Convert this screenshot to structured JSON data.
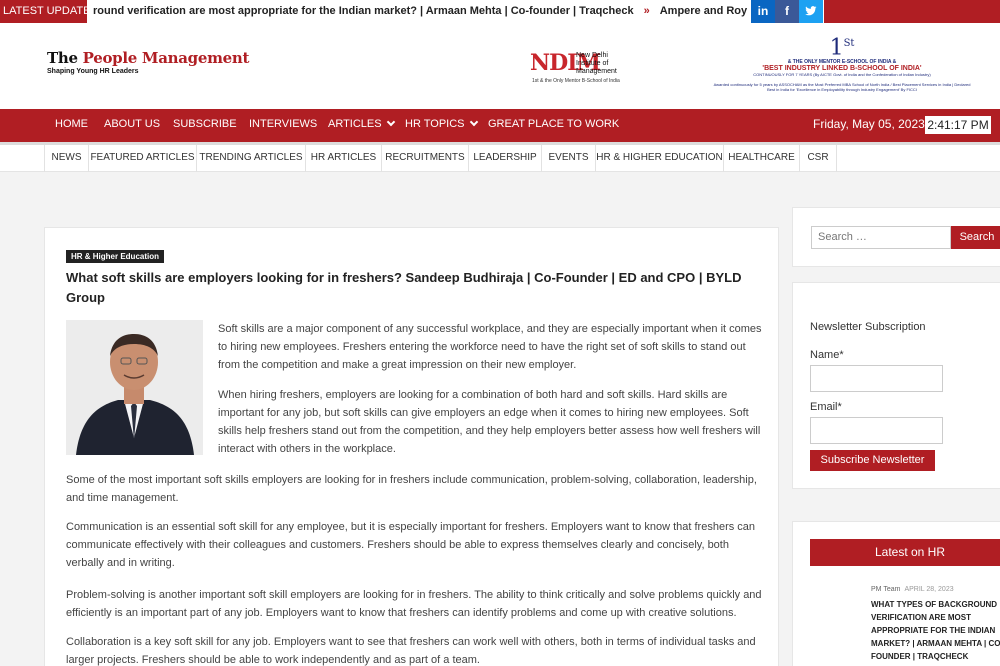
{
  "ticker": {
    "label": "LATEST UPDATES",
    "items": [
      "round verification are most appropriate for the Indian market? | Armaan Mehta | Co-founder | Traqcheck",
      "Ampere and Royal Challenger Bangal"
    ],
    "separator": "»"
  },
  "social": [
    {
      "icon": "linkedin-icon",
      "glyph": "in",
      "color": "#0a66c2"
    },
    {
      "icon": "facebook-icon",
      "glyph": "f",
      "color": "#3b5998"
    },
    {
      "icon": "twitter-icon",
      "glyph": "t",
      "color": "#1da1f2"
    }
  ],
  "brand": {
    "title_a": "The ",
    "title_b": "People Management",
    "tagline": "Shaping Young HR Leaders"
  },
  "ndim": {
    "mark": "NDIM",
    "name": "New Delhi Institute of Management",
    "sub": "1st & the Only Mentor B-School of India"
  },
  "award": {
    "rank": "1",
    "rank_sup": "St",
    "line1": "& THE ONLY MENTOR E-SCHOOL OF INDIA &",
    "line2": "'BEST INDUSTRY LINKED B-SCHOOL OF INDIA'",
    "line3": "CONTINUOUSLY FOR 7 YEARS (By AICTE Govt. of India and the Confederation of Indian Industry)",
    "line4": "Awarded continuously for 5 years by ASSOCHAM as the Most Preferred MBA School of North India / Best Placement Services in India | Declared Best in India for 'Excellence in Employability through Industry Engagement' By FICCI"
  },
  "mainnav": {
    "items": [
      "HOME",
      "ABOUT US",
      "SUBSCRIBE",
      "INTERVIEWS",
      "ARTICLES",
      "HR TOPICS",
      "GREAT PLACE TO WORK"
    ],
    "date": "Friday, May 05, 2023",
    "time": "2:41:17 PM"
  },
  "subnav": {
    "items": [
      "NEWS",
      "FEATURED ARTICLES",
      "TRENDING ARTICLES",
      "HR ARTICLES",
      "RECRUITMENTS",
      "LEADERSHIP",
      "EVENTS",
      "HR & HIGHER EDUCATION",
      "HEALTHCARE",
      "CSR"
    ]
  },
  "article": {
    "category": "HR & Higher Education",
    "title": "What soft skills are employers looking for in freshers? Sandeep Budhiraja | Co-Founder | ED and CPO | BYLD Group",
    "paragraphs": [
      "Soft skills are a major component of any successful workplace, and they are especially important when it comes to hiring new employees. Freshers entering the workforce need to have the right set of soft skills to stand out from the competition and make a great impression on their new employer.",
      "When hiring freshers, employers are looking for a combination of both hard and soft skills. Hard skills are important for any job, but soft skills can give employers an edge when it comes to hiring new employees. Soft skills help freshers stand out from the competition, and they help employers better assess how well freshers will interact with others in the workplace.",
      "Some of the most important soft skills employers are looking for in freshers include communication, problem-solving, collaboration, leadership, and time management.",
      "Communication is an essential soft skill for any employee, but it is especially important for freshers. Employers want to know that freshers can communicate effectively with their colleagues  and customers. Freshers should be able to express themselves clearly and concisely, both verbally and in writing.",
      "Problem-solving is another important soft skill employers are looking for in freshers. The ability to think critically and solve problems quickly and efficiently is an important part of any job. Employers want to know that freshers can identify problems and come up with creative solutions.",
      "Collaboration is a key soft skill for any job. Employers want to see that freshers can work well with others, both in terms of individual tasks and larger projects. Freshers should be able to work independently and as part of a team."
    ]
  },
  "sidebar": {
    "search_placeholder": "Search …",
    "search_button": "Search",
    "newsletter_title": "Newsletter Subscription",
    "name_label": "Name*",
    "email_label": "Email*",
    "subscribe_button": "Subscribe Newsletter",
    "latest_title": "Latest on HR",
    "latest_author": "PM Team",
    "latest_date": "APRIL 28, 2023",
    "latest_headline": "What types of background verification are most appropriate for the Indian market? | Armaan Mehta | Co-founder | Traqcheck"
  },
  "colors": {
    "brand_red": "#b01e23",
    "navy": "#1d2a7a"
  }
}
